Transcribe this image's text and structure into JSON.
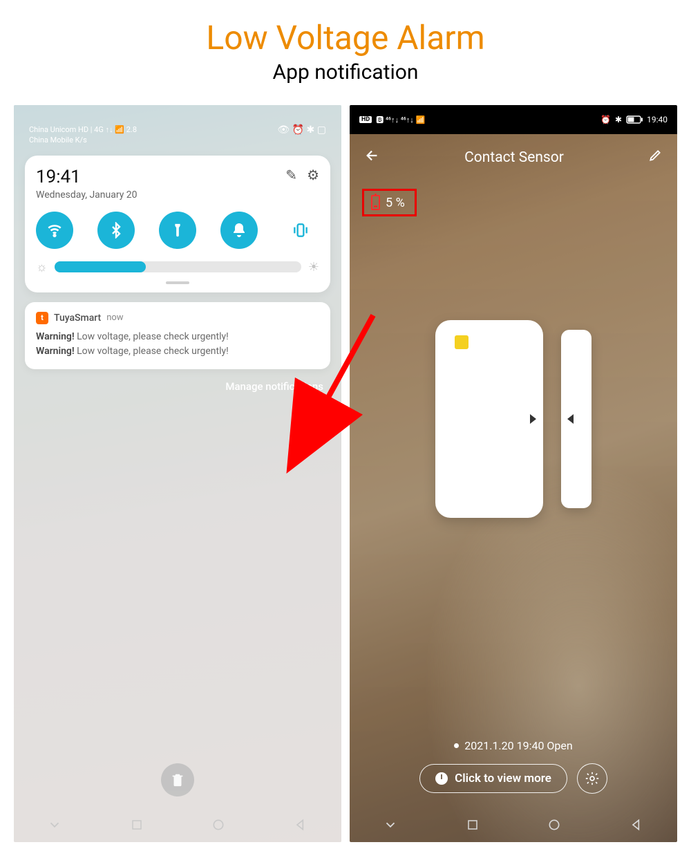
{
  "header": {
    "title": "Low Voltage Alarm",
    "subtitle": "App notification"
  },
  "left": {
    "carriers": {
      "line1": "China Unicom HD  | 4G ↑↓ 📶 2.8",
      "line2": "China Mobile             K/s"
    },
    "status_icons": "👁 ⏰ ✱ ▢",
    "qs": {
      "time": "19:41",
      "date": "Wednesday, January 20",
      "edit_icon": "✎",
      "gear_icon": "⚙"
    },
    "notif": {
      "app": "TuyaSmart",
      "time": "now",
      "line1_bold": "Warning!",
      "line1_rest": " Low voltage, please check urgently!",
      "line2_bold": "Warning!",
      "line2_rest": " Low voltage, please check urgently!"
    },
    "manage": "Manage notifications"
  },
  "right": {
    "status": {
      "hd": "HD",
      "extras": "🅱 ⁴⁶↑↓ ⁴⁶↑↓ 📶",
      "alarm": "⏰",
      "bt": "✱",
      "time": "19:40"
    },
    "title": "Contact Sensor",
    "battery": "5 %",
    "event": "2021.1.20 19:40 Open",
    "view_more": "Click to view more"
  },
  "colors": {
    "accent": "#ed8b00",
    "teal": "#1bb5d8",
    "red": "#e80000"
  }
}
